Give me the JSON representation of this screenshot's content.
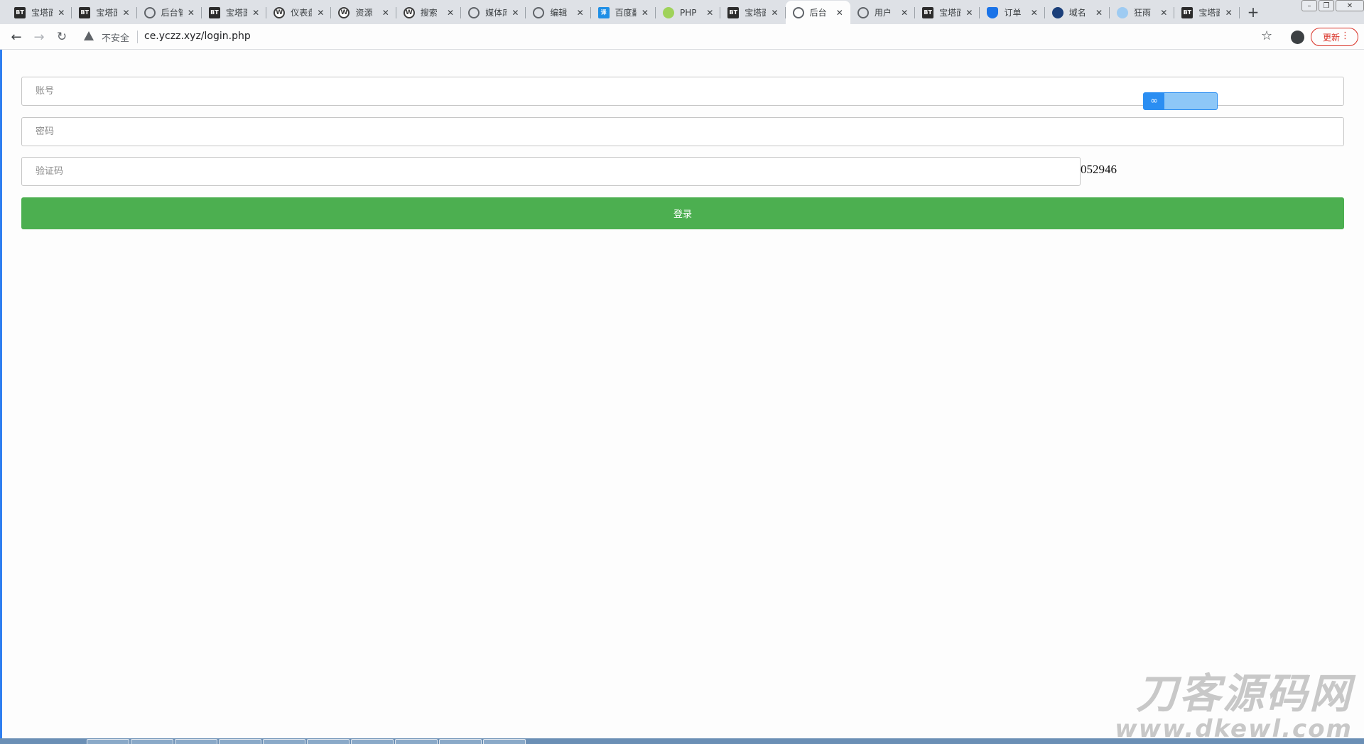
{
  "browser": {
    "tabs": [
      {
        "favicon": "bt-icon",
        "title": "宝塔面板"
      },
      {
        "favicon": "bt-icon",
        "title": "宝塔面板"
      },
      {
        "favicon": "globe-icon",
        "title": "后台管理"
      },
      {
        "favicon": "bt-icon",
        "title": "宝塔面板"
      },
      {
        "favicon": "wordpress-icon",
        "title": "仪表盘"
      },
      {
        "favicon": "wordpress-icon",
        "title": "资源"
      },
      {
        "favicon": "wordpress-icon",
        "title": "搜索"
      },
      {
        "favicon": "globe-icon",
        "title": "媒体库"
      },
      {
        "favicon": "globe-icon",
        "title": "编辑"
      },
      {
        "favicon": "translate-icon",
        "title": "百度翻译"
      },
      {
        "favicon": "php-icon",
        "title": "PHP"
      },
      {
        "favicon": "bt-icon",
        "title": "宝塔面板"
      },
      {
        "favicon": "globe-icon",
        "title": "后台",
        "active": true
      },
      {
        "favicon": "globe-icon",
        "title": "用户"
      },
      {
        "favicon": "bt-icon",
        "title": "宝塔面板"
      },
      {
        "favicon": "shield-icon",
        "title": "订单"
      },
      {
        "favicon": "wave-icon",
        "title": "域名"
      },
      {
        "favicon": "cloud-icon",
        "title": "狂雨"
      },
      {
        "favicon": "bt-icon",
        "title": "宝塔面板"
      }
    ],
    "security_label": "不安全",
    "url": "ce.yczz.xyz/login.php",
    "update_label": "更新"
  },
  "login_form": {
    "account_placeholder": "账号",
    "password_placeholder": "密码",
    "captcha_placeholder": "验证码",
    "captcha_code": "052946",
    "submit_label": "登录"
  },
  "watermark": {
    "title": "刀客源码网",
    "url": "www.dkewl.com"
  },
  "colors": {
    "primary_button": "#4caf50",
    "update_accent": "#d93025"
  }
}
